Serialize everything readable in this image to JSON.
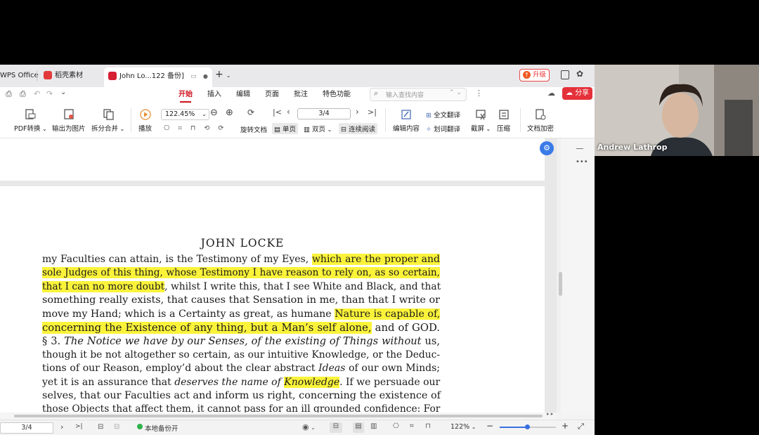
{
  "tabs": [
    {
      "label": "WPS Office",
      "icon": "wps-icon"
    },
    {
      "label": "稻壳素材",
      "icon": "docer-icon"
    },
    {
      "label": "John Lo...122 备份]",
      "icon": "pdf-icon",
      "active": true
    }
  ],
  "titlebar": {
    "upgrade_label": "升级",
    "new_tab": "+"
  },
  "menu": {
    "items": [
      "开始",
      "插入",
      "编辑",
      "页面",
      "批注",
      "特色功能"
    ],
    "active": "开始",
    "search_placeholder": "输入查找内容",
    "share_label": "分享"
  },
  "toolbar": {
    "pdf_convert": "PDF转换",
    "export_image": "输出为图片",
    "split_merge": "拆分合并",
    "play": "播放",
    "zoom": "122.45%",
    "page_indicator": "3/4",
    "rotate_doc": "旋转文档",
    "single_page": "单页",
    "double_page": "双页",
    "continuous": "连续阅读",
    "edit_content": "编辑内容",
    "full_translate": "全文翻译",
    "word_translate": "划词翻译",
    "screenshot": "截屏",
    "compress": "压缩",
    "encrypt": "文档加密"
  },
  "document": {
    "header": "JOHN LOCKE",
    "lines": [
      [
        {
          "t": "my Faculties can attain, is the Testimony of my Eyes, "
        },
        {
          "t": "which are the proper and",
          "hl": true
        }
      ],
      [
        {
          "t": "sole Judges of this thing, whose Testimony I have reason to rely on, as so certain,",
          "hl": true
        }
      ],
      [
        {
          "t": "that I can no more doubt",
          "hl": true
        },
        {
          "t": ", whilst I write this, that I see White and Black, and that"
        }
      ],
      [
        {
          "t": "something really exists, that causes that Sensation in me, than that I write or"
        }
      ],
      [
        {
          "t": "move my Hand; which is a Certainty as great, as humane "
        },
        {
          "t": "Nature is capable of,",
          "hl": true
        }
      ],
      [
        {
          "t": "concerning the Existence of any thing, but a Man’s self alone,",
          "hl": true
        },
        {
          "t": " and of GOD."
        }
      ],
      [
        {
          "t": "   § 3. "
        },
        {
          "t": "The Notice we have by our Senses, of the existing of Things without",
          "i": true
        },
        {
          "t": " us,"
        }
      ],
      [
        {
          "t": "though it be not altogether so certain, as our intuitive Knowledge, or the Deduc-"
        }
      ],
      [
        {
          "t": "tions of our Reason, employ’d about the clear abstract "
        },
        {
          "t": "Ideas",
          "i": true
        },
        {
          "t": " of our own Minds;"
        }
      ],
      [
        {
          "t": "yet it is an assurance that "
        },
        {
          "t": "deserves the name of ",
          "i": true
        },
        {
          "t": "Knowledge",
          "i": true,
          "hl": true
        },
        {
          "t": ". If we persuade our"
        }
      ],
      [
        {
          "t": "selves, that our Faculties act and inform us right, concerning the existence of"
        }
      ],
      [
        {
          "t": "those Objects that affect them, it cannot pass for an ill grounded confidence: For"
        }
      ]
    ]
  },
  "status": {
    "page": "3/4",
    "backup": "本地备份开",
    "zoom": "122%"
  },
  "video": {
    "name": "Andrew Lathrop"
  }
}
